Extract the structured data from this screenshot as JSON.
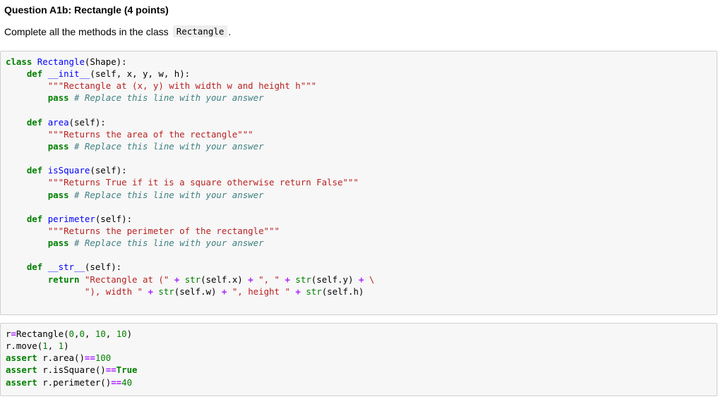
{
  "question": {
    "title": "Question A1b: Rectangle (4 points)",
    "description": "Complete all the methods in the class",
    "class_name_inline": "Rectangle",
    "description_end": "."
  },
  "code_cell": {
    "lines": [
      [
        [
          "kw",
          "class"
        ],
        [
          "t",
          " "
        ],
        [
          "cls",
          "Rectangle"
        ],
        [
          "t",
          "(Shape):"
        ]
      ],
      [
        [
          "t",
          "    "
        ],
        [
          "kw",
          "def"
        ],
        [
          "t",
          " "
        ],
        [
          "fn",
          "__init__"
        ],
        [
          "t",
          "(self, x, y, w, h):"
        ]
      ],
      [
        [
          "t",
          "        "
        ],
        [
          "str",
          "\"\"\"Rectangle at (x, y) with width w and height h\"\"\""
        ]
      ],
      [
        [
          "t",
          "        "
        ],
        [
          "kw",
          "pass"
        ],
        [
          "t",
          " "
        ],
        [
          "cm",
          "# Replace this line with your answer"
        ]
      ],
      [
        [
          "t",
          ""
        ]
      ],
      [
        [
          "t",
          "    "
        ],
        [
          "kw",
          "def"
        ],
        [
          "t",
          " "
        ],
        [
          "fn",
          "area"
        ],
        [
          "t",
          "(self):"
        ]
      ],
      [
        [
          "t",
          "        "
        ],
        [
          "str",
          "\"\"\"Returns the area of the rectangle\"\"\""
        ]
      ],
      [
        [
          "t",
          "        "
        ],
        [
          "kw",
          "pass"
        ],
        [
          "t",
          " "
        ],
        [
          "cm",
          "# Replace this line with your answer"
        ]
      ],
      [
        [
          "t",
          ""
        ]
      ],
      [
        [
          "t",
          "    "
        ],
        [
          "kw",
          "def"
        ],
        [
          "t",
          " "
        ],
        [
          "fn",
          "isSquare"
        ],
        [
          "t",
          "(self):"
        ]
      ],
      [
        [
          "t",
          "        "
        ],
        [
          "str",
          "\"\"\"Returns True if it is a square otherwise return False\"\"\""
        ]
      ],
      [
        [
          "t",
          "        "
        ],
        [
          "kw",
          "pass"
        ],
        [
          "t",
          " "
        ],
        [
          "cm",
          "# Replace this line with your answer"
        ]
      ],
      [
        [
          "t",
          ""
        ]
      ],
      [
        [
          "t",
          "    "
        ],
        [
          "kw",
          "def"
        ],
        [
          "t",
          " "
        ],
        [
          "fn",
          "perimeter"
        ],
        [
          "t",
          "(self):"
        ]
      ],
      [
        [
          "t",
          "        "
        ],
        [
          "str",
          "\"\"\"Returns the perimeter of the rectangle\"\"\""
        ]
      ],
      [
        [
          "t",
          "        "
        ],
        [
          "kw",
          "pass"
        ],
        [
          "t",
          " "
        ],
        [
          "cm",
          "# Replace this line with your answer"
        ]
      ],
      [
        [
          "t",
          ""
        ]
      ],
      [
        [
          "t",
          "    "
        ],
        [
          "kw",
          "def"
        ],
        [
          "t",
          " "
        ],
        [
          "fn",
          "__str__"
        ],
        [
          "t",
          "(self):"
        ]
      ],
      [
        [
          "t",
          "        "
        ],
        [
          "kw",
          "return"
        ],
        [
          "t",
          " "
        ],
        [
          "str",
          "\"Rectangle at (\""
        ],
        [
          "t",
          " "
        ],
        [
          "op",
          "+"
        ],
        [
          "t",
          " "
        ],
        [
          "bi",
          "str"
        ],
        [
          "t",
          "(self.x) "
        ],
        [
          "op",
          "+"
        ],
        [
          "t",
          " "
        ],
        [
          "str",
          "\", \""
        ],
        [
          "t",
          " "
        ],
        [
          "op",
          "+"
        ],
        [
          "t",
          " "
        ],
        [
          "bi",
          "str"
        ],
        [
          "t",
          "(self.y) "
        ],
        [
          "op",
          "+"
        ],
        [
          "t",
          " "
        ],
        [
          "str",
          "\\"
        ]
      ],
      [
        [
          "t",
          "               "
        ],
        [
          "str",
          "\"), width \""
        ],
        [
          "t",
          " "
        ],
        [
          "op",
          "+"
        ],
        [
          "t",
          " "
        ],
        [
          "bi",
          "str"
        ],
        [
          "t",
          "(self.w) "
        ],
        [
          "op",
          "+"
        ],
        [
          "t",
          " "
        ],
        [
          "str",
          "\", height \""
        ],
        [
          "t",
          " "
        ],
        [
          "op",
          "+"
        ],
        [
          "t",
          " "
        ],
        [
          "bi",
          "str"
        ],
        [
          "t",
          "(self.h)"
        ]
      ]
    ]
  },
  "test_cell": {
    "lines": [
      [
        [
          "t",
          "r"
        ],
        [
          "op",
          "="
        ],
        [
          "t",
          "Rectangle("
        ],
        [
          "num",
          "0"
        ],
        [
          "t",
          ","
        ],
        [
          "num",
          "0"
        ],
        [
          "t",
          ", "
        ],
        [
          "num",
          "10"
        ],
        [
          "t",
          ", "
        ],
        [
          "num",
          "10"
        ],
        [
          "t",
          ")"
        ]
      ],
      [
        [
          "t",
          "r.move("
        ],
        [
          "num",
          "1"
        ],
        [
          "t",
          ", "
        ],
        [
          "num",
          "1"
        ],
        [
          "t",
          ")"
        ]
      ],
      [
        [
          "kw",
          "assert"
        ],
        [
          "t",
          " r.area()"
        ],
        [
          "op",
          "=="
        ],
        [
          "num",
          "100"
        ]
      ],
      [
        [
          "kw",
          "assert"
        ],
        [
          "t",
          " r.isSquare()"
        ],
        [
          "op",
          "=="
        ],
        [
          "kw",
          "True"
        ]
      ],
      [
        [
          "kw",
          "assert"
        ],
        [
          "t",
          " r.perimeter()"
        ],
        [
          "op",
          "=="
        ],
        [
          "num",
          "40"
        ]
      ]
    ]
  }
}
